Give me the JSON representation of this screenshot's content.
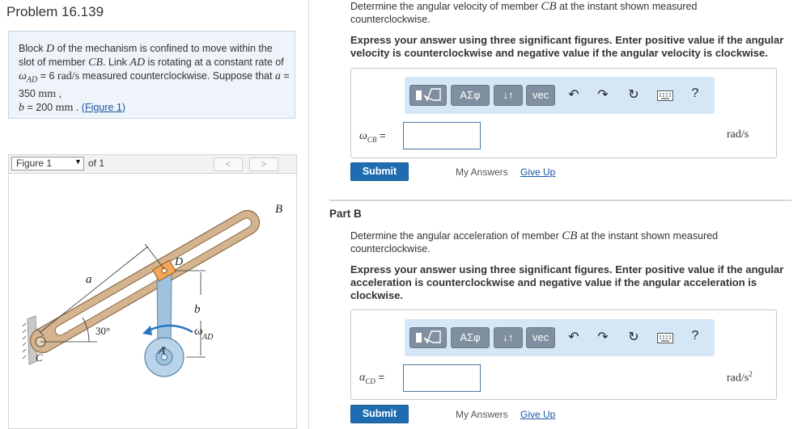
{
  "problem": {
    "title": "Problem 16.139",
    "statement": {
      "p1": "Block ",
      "D": "D",
      "p2": " of the mechanism is confined to move within the slot of member ",
      "CB": "CB",
      "p3": ". Link ",
      "AD": "AD",
      "p4": " is rotating at a constant rate of ",
      "omega": "ω",
      "omega_sub": "AD",
      "p5": " = 6 ",
      "rads": "rad/s",
      "p6": " measured counterclockwise. Suppose that ",
      "a": "a",
      "p7": " = 350 ",
      "mm1": "mm",
      "p8": " ,",
      "b": "b",
      "p9": " = 200 ",
      "mm2": "mm",
      "p10": " . ",
      "figure_link": "(Figure 1)"
    }
  },
  "figure_nav": {
    "selected": "Figure 1",
    "of_label": "of 1",
    "prev": "<",
    "next": ">"
  },
  "figure": {
    "label_B": "B",
    "label_D": "D",
    "label_a": "a",
    "label_b": "b",
    "label_angle": "30°",
    "label_omega": "ω",
    "label_omega_sub": "AD",
    "label_A": "A",
    "label_C": "C"
  },
  "part_a": {
    "question_1": "Determine the angular velocity of member ",
    "question_var": "CB",
    "question_2": " at the instant shown measured counterclockwise.",
    "instruction": "Express your answer using three significant figures. Enter positive value if the angular velocity is counterclockwise and negative value if the angular velocity is clockwise.",
    "var_symbol": "ω",
    "var_sub": "CB",
    "equals": " =",
    "input_value": "",
    "unit": "rad/s",
    "submit": "Submit",
    "my_answers": "My Answers",
    "give_up": "Give Up"
  },
  "part_b": {
    "title": "Part B",
    "question_1": "Determine the angular acceleration of member ",
    "question_var": "CB",
    "question_2": " at the instant shown measured counterclockwise.",
    "instruction": "Express your answer using three significant figures. Enter positive value if the angular acceleration is counterclockwise and negative value if the angular acceleration is clockwise.",
    "var_symbol": "α",
    "var_sub": "CD",
    "equals": " =",
    "input_value": "",
    "unit": "rad/s",
    "unit_sup": "2",
    "submit": "Submit",
    "my_answers": "My Answers",
    "give_up": "Give Up"
  },
  "toolbar": {
    "templates_icon": "templates-icon",
    "greek_label": "ΑΣφ",
    "arrows_label": "↓↑",
    "vec_label": "vec",
    "undo_icon": "undo-icon",
    "redo_icon": "redo-icon",
    "reset_icon": "reset-icon",
    "keyboard_icon": "keyboard-icon",
    "help_label": "?"
  },
  "colors": {
    "submit_bg": "#1f6db0",
    "toolbar_bg": "#d5e6f7",
    "toolbar_button": "#7f8fa0",
    "problem_box_bg": "#eef4f9",
    "link": "#1a56a6"
  }
}
